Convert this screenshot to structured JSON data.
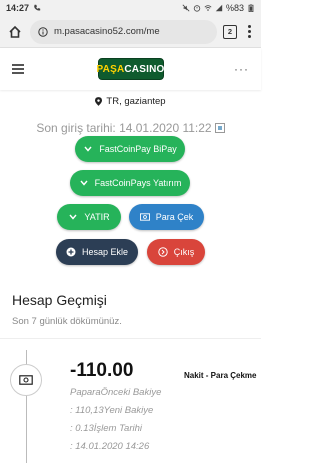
{
  "status_bar": {
    "time": "14:27",
    "battery": "%83"
  },
  "browser": {
    "url": "m.pasacasino52.com/me",
    "tab_count": "2"
  },
  "header": {
    "logo_part1": "PAŞA",
    "logo_part2": "CASINO",
    "more_label": "···"
  },
  "location": "TR, gaziantep",
  "last_login": "Son giriş tarihi: 14.01.2020 11:22",
  "buttons": {
    "fastcoinpay_bipay": "FastCoinPay BiPay",
    "fastcoinpays_yatirim": "FastCoinPays Yatırım",
    "yatir": "YATIR",
    "para_cek": "Para Çek",
    "hesap_ekle": "Hesap Ekle",
    "cikis": "Çıkış"
  },
  "history": {
    "title": "Hesap Geçmişi",
    "subtitle": "Son 7 günlük dökümünüz.",
    "items": [
      {
        "amount": "-110.00",
        "type": "Nakit - Para Çekme",
        "line1": "PaparaÖnceki Bakiye",
        "line2": ": 110,13Yeni Bakiye",
        "line3": ": 0.13İşlem Tarihi",
        "line4": ": 14.01.2020 14:26"
      }
    ]
  },
  "colors": {
    "green": "#26b35a",
    "blue": "#2f82c8",
    "dark": "#2c3e55",
    "red": "#d9453b",
    "logo_bg": "#0f5b2e",
    "logo_accent": "#ffd200"
  }
}
